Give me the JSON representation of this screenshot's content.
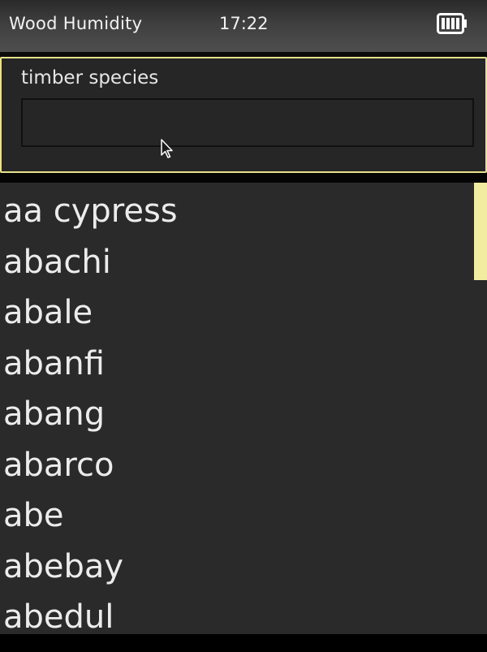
{
  "status_bar": {
    "title": "Wood Humidity",
    "time": "17:22",
    "battery_icon": "battery-full-icon"
  },
  "search": {
    "label": "timber species",
    "value": "",
    "placeholder": ""
  },
  "species_list": {
    "items": [
      "aa cypress",
      "abachi",
      "abale",
      "abanfi",
      "abang",
      "abarco",
      "abe",
      "abebay",
      "abedul"
    ]
  },
  "colors": {
    "accent": "#e8e28c",
    "scroll_thumb": "#f2eca0",
    "background": "#2a2a2a",
    "text": "#ececec"
  }
}
